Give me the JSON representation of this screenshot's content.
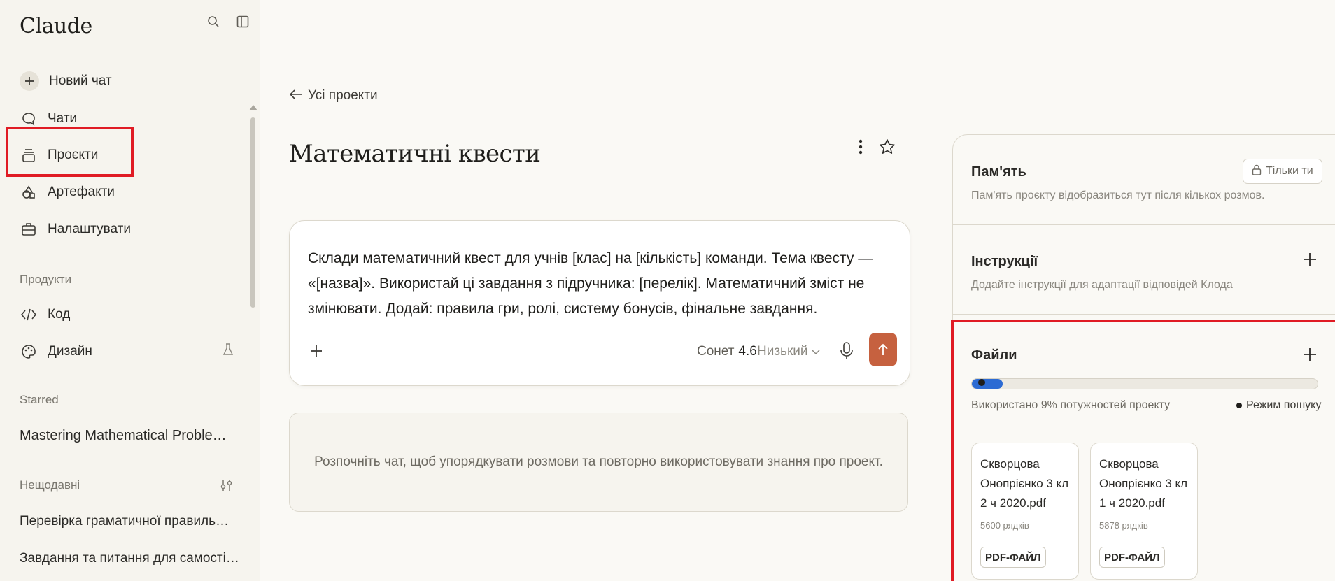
{
  "sidebar": {
    "brand": "Claude",
    "nav": [
      {
        "label": "Новий чат",
        "icon": "plus-icon"
      },
      {
        "label": "Чати",
        "icon": "chat-bubble-icon"
      },
      {
        "label": "Проєкти",
        "icon": "folder-stack-icon"
      },
      {
        "label": "Артефакти",
        "icon": "shapes-icon"
      },
      {
        "label": "Налаштувати",
        "icon": "briefcase-icon"
      }
    ],
    "products_label": "Продукти",
    "products": [
      {
        "label": "Код",
        "icon": "code-icon"
      },
      {
        "label": "Дизайн",
        "icon": "palette-icon",
        "badge_icon": "flask-icon"
      }
    ],
    "starred_label": "Starred",
    "starred": [
      "Mastering Mathematical Proble…"
    ],
    "recent_label": "Нещодавні",
    "recent": [
      "Перевірка граматичної правиль…",
      "Завдання та питання для самості…"
    ]
  },
  "main": {
    "back_label": "Усі проекти",
    "title": "Математичні квести",
    "composer": {
      "text": "Склади математичний квест для учнів [клас] на [кількість] команди. Тема квесту — «[назва]». Використай ці завдання з підручника: [перелік]. Математичний зміст не змінювати. Додай: правила гри, ролі, систему бонусів, фінальне завдання.",
      "model_name": "Сонет",
      "model_version": "4.6",
      "effort": "Низький"
    },
    "empty_text": "Розпочніть чат, щоб упорядкувати розмови та повторно використовувати знання про проект."
  },
  "panel": {
    "memory": {
      "title": "Пам'ять",
      "subtitle": "Пам'ять проєкту відобразиться тут після кількох розмов.",
      "visibility": "Тільки ти"
    },
    "instructions": {
      "title": "Інструкції",
      "subtitle": "Додайте інструкції для адаптації відповідей Клода"
    },
    "files": {
      "title": "Файли",
      "usage_percent": 9,
      "usage_text": "Використано 9% потужностей проекту",
      "search_mode": "Режим пошуку",
      "items": [
        {
          "name": "Скворцова Онопрієнко 3 кл 2 ч 2020.pdf",
          "lines": "5600 рядків",
          "type": "PDF-ФАЙЛ"
        },
        {
          "name": "Скворцова Онопрієнко 3 кл 1 ч 2020.pdf",
          "lines": "5878 рядків",
          "type": "PDF-ФАЙЛ"
        }
      ]
    }
  },
  "colors": {
    "accent": "#c6613f",
    "highlight": "#e01b24",
    "progress": "#2c6bd3"
  }
}
